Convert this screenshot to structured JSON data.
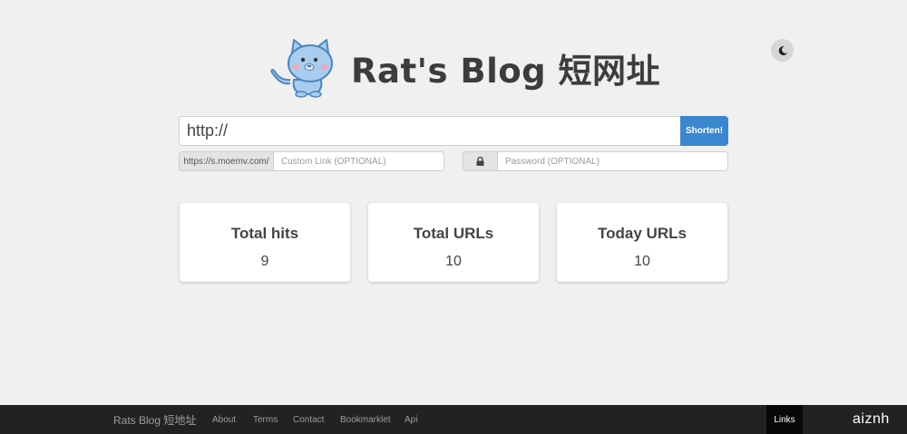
{
  "header": {
    "title": "Rat's Blog 短网址"
  },
  "shorten": {
    "url_value": "http://",
    "button_label": "Shorten!"
  },
  "custom_link": {
    "prefix": "https://s.moemv.com/",
    "placeholder": "Custom Link (OPTIONAL)"
  },
  "password": {
    "icon": "lock-icon",
    "placeholder": "Password (OPTIONAL)"
  },
  "stats": [
    {
      "label": "Total hits",
      "value": "9"
    },
    {
      "label": "Total URLs",
      "value": "10"
    },
    {
      "label": "Today URLs",
      "value": "10"
    }
  ],
  "footer": {
    "brand": "Rats Blog 短地址",
    "nav": [
      "About",
      "Terms",
      "Contact",
      "Bookmarklet",
      "Api"
    ],
    "links_label": "Links",
    "watermark": "aiznh"
  },
  "colors": {
    "accent": "#3a86cf",
    "background": "#f0f0f0",
    "footer": "#222222"
  }
}
